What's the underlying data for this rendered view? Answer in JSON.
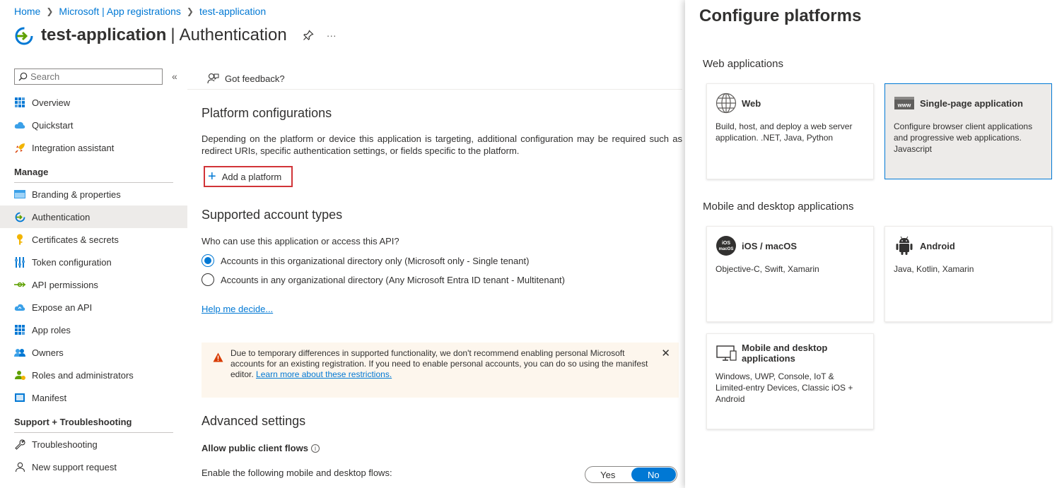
{
  "breadcrumb": {
    "home": "Home",
    "registrations": "Microsoft | App registrations",
    "app": "test-application"
  },
  "header": {
    "app_name": "test-application",
    "divider": "|",
    "page": "Authentication",
    "more": "···"
  },
  "sidebar": {
    "search_placeholder": "Search",
    "collapse": "«",
    "top_items": [
      {
        "label": "Overview",
        "icon": "grid-icon"
      },
      {
        "label": "Quickstart",
        "icon": "cloud-icon"
      },
      {
        "label": "Integration assistant",
        "icon": "rocket-icon"
      }
    ],
    "manage_title": "Manage",
    "manage_items": [
      {
        "label": "Branding & properties",
        "icon": "www-icon"
      },
      {
        "label": "Authentication",
        "icon": "auth-icon"
      },
      {
        "label": "Certificates & secrets",
        "icon": "key-icon"
      },
      {
        "label": "Token configuration",
        "icon": "sliders-icon"
      },
      {
        "label": "API permissions",
        "icon": "arrows-icon"
      },
      {
        "label": "Expose an API",
        "icon": "cloud-api-icon"
      },
      {
        "label": "App roles",
        "icon": "grid-roles-icon"
      },
      {
        "label": "Owners",
        "icon": "people-icon"
      },
      {
        "label": "Roles and administrators",
        "icon": "person-admin-icon"
      },
      {
        "label": "Manifest",
        "icon": "manifest-icon"
      }
    ],
    "support_title": "Support + Troubleshooting",
    "support_items": [
      {
        "label": "Troubleshooting",
        "icon": "wrench-icon"
      },
      {
        "label": "New support request",
        "icon": "person-support-icon"
      }
    ]
  },
  "main": {
    "feedback": "Got feedback?",
    "platform_title": "Platform configurations",
    "platform_desc": "Depending on the platform or device this application is targeting, additional configuration may be required such as redirect URIs, specific authentication settings, or fields specific to the platform.",
    "add_platform": "Add a platform",
    "account_title": "Supported account types",
    "account_question": "Who can use this application or access this API?",
    "radio_single": "Accounts in this organizational directory only (Microsoft only - Single tenant)",
    "radio_multi": "Accounts in any organizational directory (Any Microsoft Entra ID tenant - Multitenant)",
    "help_link": "Help me decide...",
    "warning_text": "Due to temporary differences in supported functionality, we don't recommend enabling personal Microsoft accounts for an existing registration. If you need to enable personal accounts, you can do so using the manifest editor.",
    "warning_link": "Learn more about these restrictions.",
    "warning_close": "✕",
    "advanced_title": "Advanced settings",
    "public_flows": "Allow public client flows",
    "info": "i",
    "flows_label": "Enable the following mobile and desktop flows:",
    "toggle_yes": "Yes",
    "toggle_no": "No"
  },
  "panel": {
    "title": "Configure platforms",
    "web_section": "Web applications",
    "mobile_section": "Mobile and desktop applications",
    "cards": {
      "web": {
        "title": "Web",
        "desc": "Build, host, and deploy a web server application. .NET, Java, Python"
      },
      "spa": {
        "title": "Single-page application",
        "desc": "Configure browser client applications and progressive web applications. Javascript"
      },
      "ios": {
        "title": "iOS / macOS",
        "desc": "Objective-C, Swift, Xamarin",
        "badge_line1": "iOS",
        "badge_line2": "macOS"
      },
      "android": {
        "title": "Android",
        "desc": "Java, Kotlin, Xamarin"
      },
      "desktop": {
        "title": "Mobile and desktop applications",
        "desc": "Windows, UWP, Console, IoT & Limited-entry Devices, Classic iOS + Android"
      }
    },
    "www_badge": "www"
  },
  "colors": {
    "accent": "#0078d4",
    "highlight_border": "#d13438",
    "warning_bg": "#fdf6ed",
    "warning_icon": "#d83b01"
  }
}
